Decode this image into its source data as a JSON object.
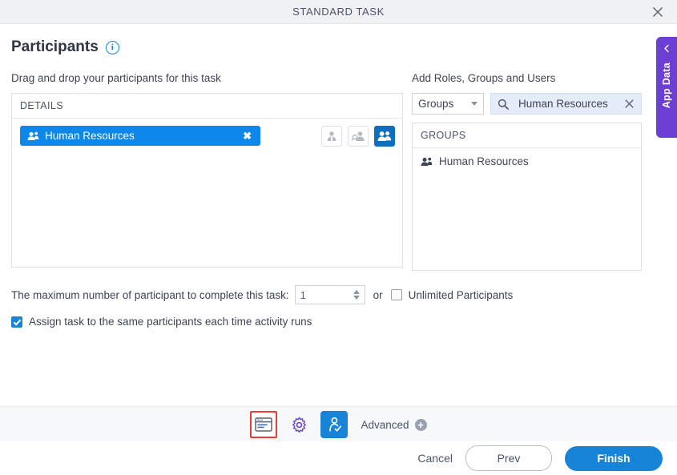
{
  "window": {
    "title": "STANDARD TASK",
    "close_label": "✕"
  },
  "app_data_tab": {
    "label": "App Data",
    "chevron": "‹"
  },
  "page": {
    "title": "Participants",
    "info_glyph": "i"
  },
  "left": {
    "instruction": "Drag and drop your participants for this task",
    "panel_header": "DETAILS",
    "chip": {
      "label": "Human Resources",
      "remove_glyph": "✖"
    },
    "filters": [
      {
        "name": "roles-filter",
        "active": false
      },
      {
        "name": "users-filter",
        "active": false
      },
      {
        "name": "groups-filter",
        "active": true
      }
    ]
  },
  "right": {
    "instruction": "Add Roles, Groups and Users",
    "select_value": "Groups",
    "search_value": "Human Resources",
    "search_placeholder": "Search",
    "clear_glyph": "✕",
    "panel_header": "GROUPS",
    "results": [
      {
        "label": "Human Resources"
      }
    ]
  },
  "options": {
    "max_label": "The maximum number of participant to complete this task:",
    "max_value": "1",
    "or_label": "or",
    "unlimited_label": "Unlimited Participants",
    "unlimited_checked": false,
    "assign_label": "Assign task to the same participants each time activity runs",
    "assign_checked": true
  },
  "toolbar": {
    "items": [
      {
        "name": "form-icon",
        "state": "highlighted"
      },
      {
        "name": "gear-icon",
        "state": "normal"
      },
      {
        "name": "participants-icon",
        "state": "active"
      }
    ],
    "advanced_label": "Advanced",
    "advanced_plus": "+"
  },
  "footer": {
    "cancel_label": "Cancel",
    "prev_label": "Prev",
    "finish_label": "Finish"
  },
  "colors": {
    "accent_blue": "#1884d8",
    "chip_blue": "#0d87e9",
    "purple": "#6b3fd4",
    "highlight_red": "#ee3b33",
    "titlebar_bg": "#f0f1f3",
    "search_bg": "#e4ecf8"
  }
}
